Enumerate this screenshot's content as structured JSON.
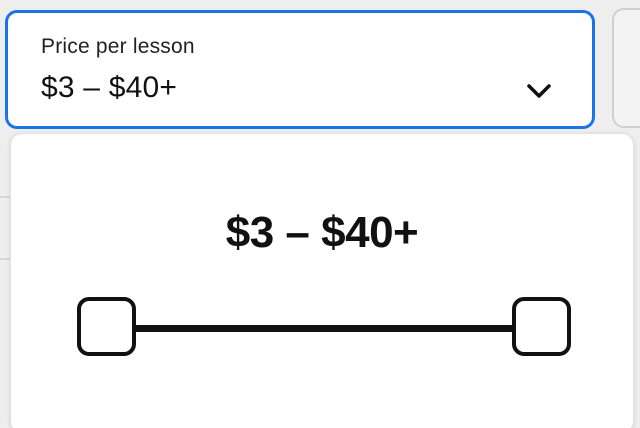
{
  "filter": {
    "label": "Price per lesson",
    "value": "$3 – $40+"
  },
  "panel": {
    "range_text": "$3 – $40+",
    "slider": {
      "min_value": 3,
      "max_value": 40,
      "min_fraction": 0,
      "max_fraction": 1
    }
  },
  "colors": {
    "accent": "#1a73e8",
    "text": "#111111",
    "panel_bg": "#ffffff"
  },
  "icons": {
    "dropdown": "chevron-down-icon"
  }
}
